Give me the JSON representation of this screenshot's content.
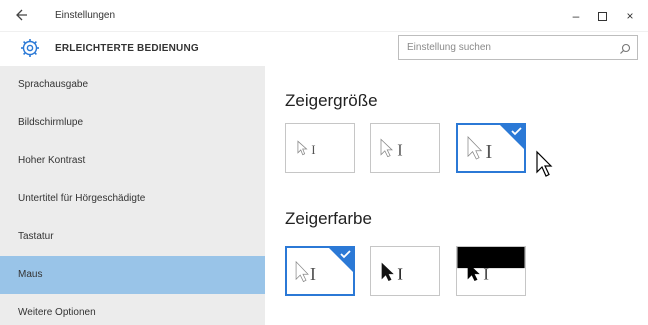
{
  "window": {
    "title": "Einstellungen",
    "min_glyph": "–",
    "close_glyph": "×"
  },
  "header": {
    "app_title": "ERLEICHTERTE BEDIENUNG",
    "search_placeholder": "Einstellung suchen"
  },
  "sidebar": {
    "items": [
      {
        "label": "Sprachausgabe"
      },
      {
        "label": "Bildschirmlupe"
      },
      {
        "label": "Hoher Kontrast"
      },
      {
        "label": "Untertitel für Hörgeschädigte"
      },
      {
        "label": "Tastatur"
      },
      {
        "label": "Maus",
        "selected": true
      },
      {
        "label": "Weitere Optionen"
      }
    ]
  },
  "main": {
    "pointer_size": {
      "title": "Zeigergröße",
      "options": [
        "small",
        "medium",
        "large"
      ],
      "selected_index": 2
    },
    "pointer_color": {
      "title": "Zeigerfarbe",
      "options": [
        "white",
        "black",
        "inverted"
      ],
      "selected_index": 0
    }
  },
  "colors": {
    "accent": "#2b79d6",
    "sidebar_bg": "#ececec",
    "sidebar_selected": "#99c4e8"
  }
}
